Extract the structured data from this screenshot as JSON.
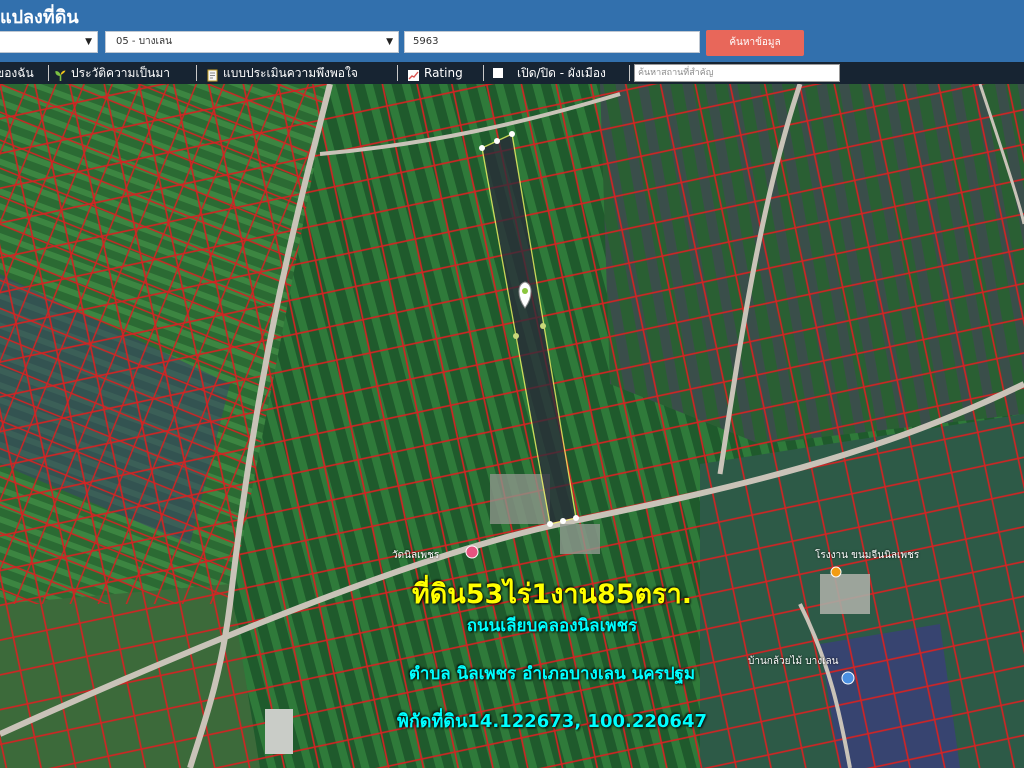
{
  "header": {
    "title": "แปลงที่ดิน",
    "province_select": "",
    "district_select": "05 - บางเลน",
    "parcel_input": "5963",
    "search_button": "ค้นหาข้อมูล"
  },
  "toolbar": {
    "items": [
      {
        "label": "ของฉัน",
        "icon": "star-icon"
      },
      {
        "label": "ประวัติความเป็นมา",
        "icon": "sprout-icon"
      },
      {
        "label": "แบบประเมินความพึงพอใจ",
        "icon": "document-icon"
      },
      {
        "label": "Rating",
        "icon": "chart-icon"
      },
      {
        "label": "เปิด/ปิด - ผังเมือง",
        "icon": "checkbox-icon"
      }
    ],
    "place_search_placeholder": "ค้นหาสถานที่สำคัญ"
  },
  "map": {
    "overlay_lines": [
      "ที่ดิน53ไร่1งาน85ตรา.",
      "ถนนเลียบคลองนิลเพชร",
      "ตำบล นิลเพชร อำเภอบางเลน นครปฐม",
      "พิกัดที่ดิน14.122673, 100.220647"
    ],
    "poi_labels": [
      "วัดนิลเพชร",
      "โรงงาน ขนมจีนนิลเพชร",
      "บ้านกล้วยไม้ บางเลน"
    ],
    "colors": {
      "parcel_border": "#e02a2a",
      "selected_parcel": "#ffff66",
      "title_yellow": "#ffff00",
      "caption_cyan": "#00ffff"
    }
  }
}
